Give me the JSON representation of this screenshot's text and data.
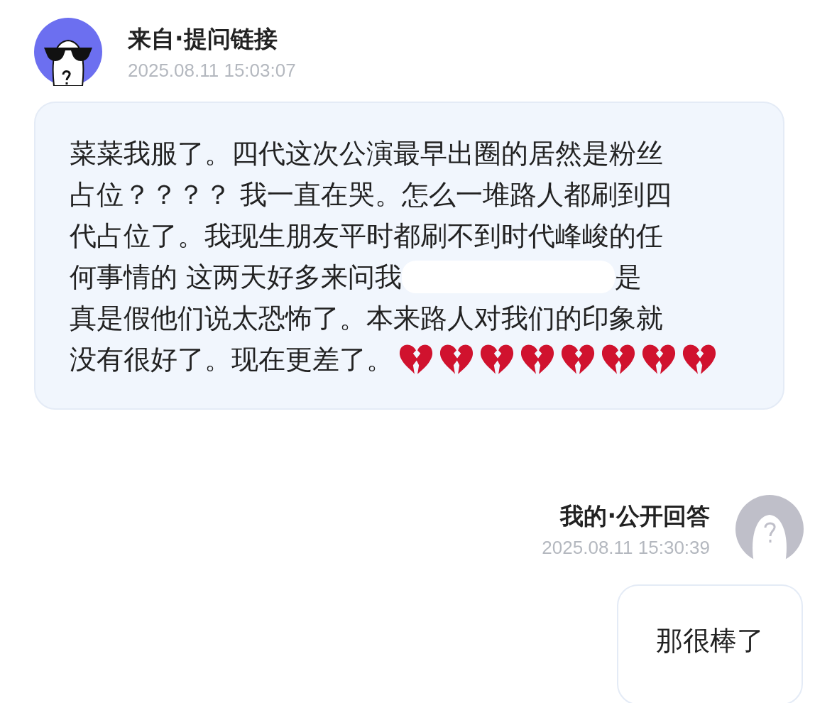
{
  "question": {
    "sender": "来自·提问链接",
    "time": "2025.08.11 15:03:07",
    "lines": [
      {
        "text": "菜菜我服了。四代这次公演最早出圈的居然是粉丝"
      },
      {
        "text": "占位？？？？ 我一直在哭。怎么一堆路人都刷到四"
      },
      {
        "text": "代占位了。我现生朋友平时都刷不到时代峰峻的任"
      },
      {
        "text": "何事情的 这两天好多来问我",
        "redacted": true,
        "text_after": "是"
      },
      {
        "text": "真是假他们说太恐怖了。本来路人对我们的印象就"
      },
      {
        "text": "没有很好了。现在更差了。",
        "icons": [
          {
            "kind": "broken-heart"
          },
          {
            "kind": "broken-heart"
          },
          {
            "kind": "broken-heart"
          },
          {
            "kind": "broken-heart"
          },
          {
            "kind": "broken-heart"
          },
          {
            "kind": "broken-heart"
          },
          {
            "kind": "broken-heart"
          },
          {
            "kind": "broken-heart"
          }
        ]
      }
    ]
  },
  "answer": {
    "sender": "我的·公开回答",
    "time": "2025.08.11 15:30:39",
    "text": "那很棒了"
  }
}
